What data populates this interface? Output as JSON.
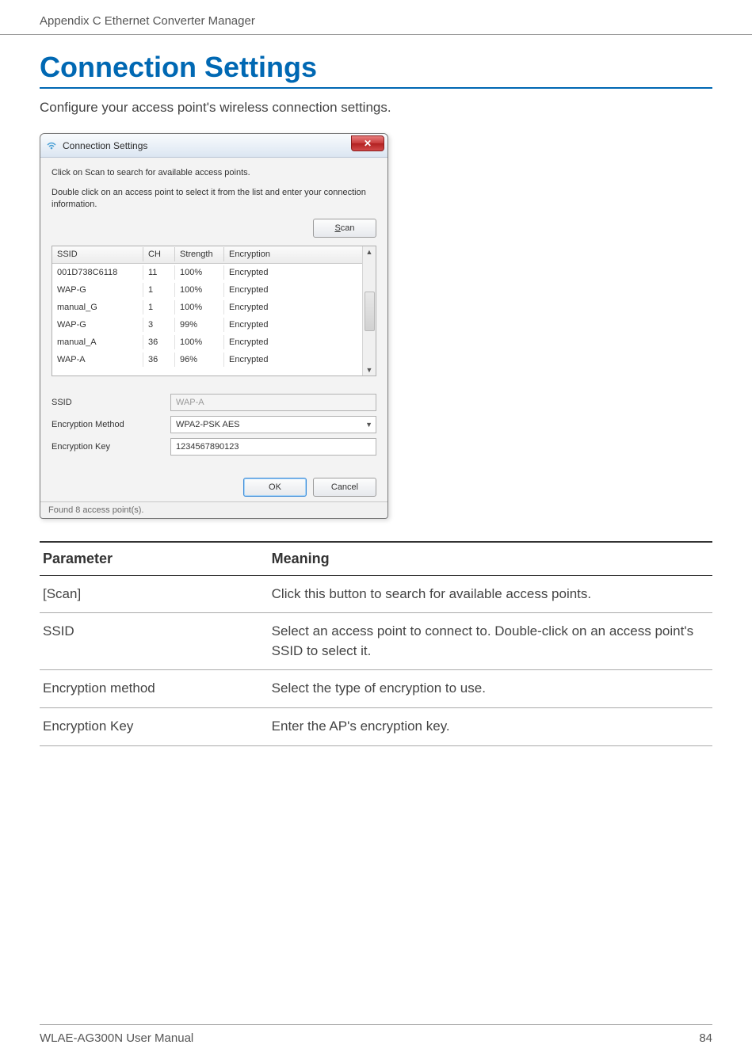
{
  "header": {
    "left": "Appendix C  Ethernet Converter Manager"
  },
  "title": "Connection Settings",
  "intro": "Configure your access point's wireless connection settings.",
  "dialog": {
    "title": "Connection Settings",
    "close_glyph": "✕",
    "help1": "Click on Scan to search for available access points.",
    "help2": "Double click on an access point to select it from the list and enter your connection information.",
    "scan_btn": "Scan",
    "headers": {
      "ssid": "SSID",
      "ch": "CH",
      "str": "Strength",
      "enc": "Encryption"
    },
    "rows": [
      {
        "ssid": "001D738C6118",
        "ch": "11",
        "str": "100%",
        "enc": "Encrypted"
      },
      {
        "ssid": "WAP-G",
        "ch": "1",
        "str": "100%",
        "enc": "Encrypted"
      },
      {
        "ssid": "manual_G",
        "ch": "1",
        "str": "100%",
        "enc": "Encrypted"
      },
      {
        "ssid": "WAP-G",
        "ch": "3",
        "str": "99%",
        "enc": "Encrypted"
      },
      {
        "ssid": "manual_A",
        "ch": "36",
        "str": "100%",
        "enc": "Encrypted"
      },
      {
        "ssid": "WAP-A",
        "ch": "36",
        "str": "96%",
        "enc": "Encrypted"
      }
    ],
    "labels": {
      "ssid": "SSID",
      "method": "Encryption Method",
      "key": "Encryption Key"
    },
    "values": {
      "ssid": "WAP-A",
      "method": "WPA2-PSK AES",
      "key": "1234567890123"
    },
    "ok_btn": "OK",
    "cancel_btn": "Cancel",
    "status": "Found 8 access point(s)."
  },
  "table": {
    "head": {
      "param": "Parameter",
      "meaning": "Meaning"
    },
    "rows": [
      {
        "param": "[Scan]",
        "meaning": "Click this button to search for available access points."
      },
      {
        "param": "SSID",
        "meaning": "Select an access point to connect to.  Double-click on an access point's SSID to select it."
      },
      {
        "param": "Encryption method",
        "meaning": "Select the type of encryption to use."
      },
      {
        "param": "Encryption Key",
        "meaning": "Enter the AP's encryption key."
      }
    ]
  },
  "footer": {
    "left": "WLAE-AG300N User Manual",
    "right": "84"
  }
}
